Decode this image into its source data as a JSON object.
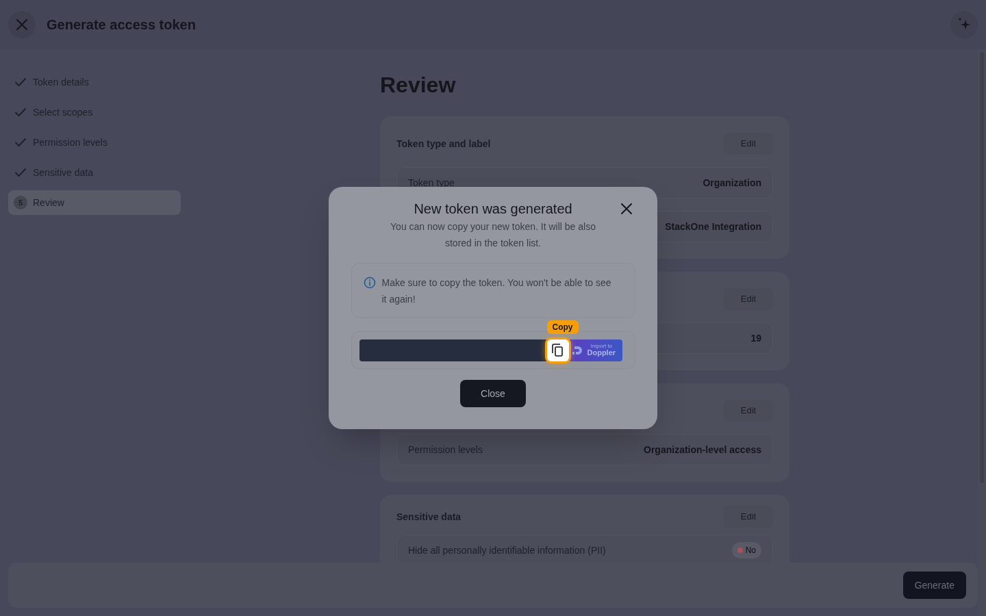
{
  "header": {
    "title": "Generate access token"
  },
  "steps": [
    {
      "label": "Token details",
      "done": true,
      "selected": false
    },
    {
      "label": "Select scopes",
      "done": true,
      "selected": false
    },
    {
      "label": "Permission levels",
      "done": true,
      "selected": false
    },
    {
      "label": "Sensitive data",
      "done": true,
      "selected": false
    },
    {
      "label": "Review",
      "number": "5",
      "done": false,
      "selected": true
    }
  ],
  "page_title": "Review",
  "cards": [
    {
      "title": "Token type and label",
      "edit": "Edit",
      "rows": [
        {
          "label": "Token type",
          "value": "Organization"
        },
        {
          "value": "StackOne Integration"
        }
      ]
    },
    {
      "edit": "Edit",
      "rows": [
        {
          "value": "19"
        }
      ]
    },
    {
      "edit": "Edit",
      "rows": [
        {
          "label": "Permission levels",
          "value": "Organization-level access"
        }
      ]
    },
    {
      "title": "Sensitive data",
      "edit": "Edit",
      "rows": [
        {
          "label": "Hide all personally identifiable information (PII)",
          "badge": {
            "text": "No",
            "color": "#a8505e"
          }
        }
      ]
    }
  ],
  "footer": {
    "button": "Generate"
  },
  "modal": {
    "title": "New token was generated",
    "description": "You can now copy your new token. It will be also stored in the token list.",
    "notice": "Make sure to copy the token. You won't be able to see it again!",
    "tooltip": "Copy",
    "doppler_small": "Import to",
    "doppler_large": "Doppler",
    "close_button": "Close"
  }
}
